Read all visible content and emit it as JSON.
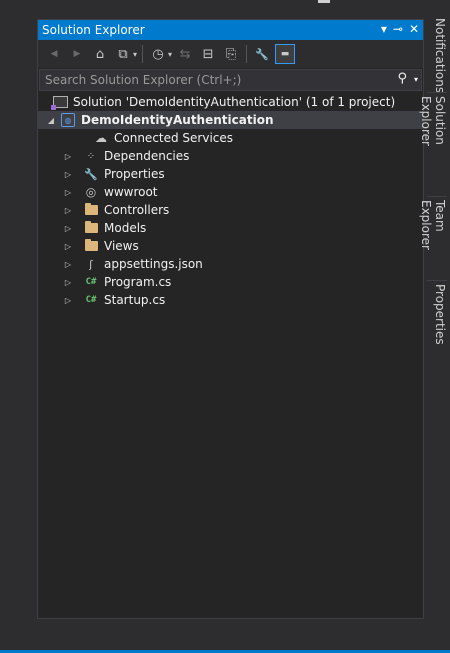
{
  "panel": {
    "title": "Solution Explorer",
    "title_icons": {
      "dropdown": "▾",
      "pin": "⊸",
      "close": "✕"
    }
  },
  "toolbar": {
    "buttons": [
      {
        "name": "back-button",
        "icon": "◀"
      },
      {
        "name": "forward-button",
        "icon": "▶"
      },
      {
        "name": "home-button",
        "icon": "⌂"
      },
      {
        "name": "switch-views-button",
        "icon": "⧉"
      },
      {
        "name": "pending-changes-button",
        "icon": "◷"
      },
      {
        "name": "sync-button",
        "icon": "⇆"
      },
      {
        "name": "collapse-all-button",
        "icon": "⊟"
      },
      {
        "name": "show-all-files-button",
        "icon": "⎘"
      },
      {
        "name": "properties-button",
        "icon": "🔧"
      },
      {
        "name": "preview-selected-button",
        "icon": "▬"
      }
    ]
  },
  "search": {
    "placeholder": "Search Solution Explorer (Ctrl+;)"
  },
  "tree": {
    "solution": "Solution 'DemoIdentityAuthentication' (1 of 1 project)",
    "project": "DemoIdentityAuthentication",
    "items": [
      {
        "label": "Connected Services",
        "icon": "cloud-icon",
        "expandable": false
      },
      {
        "label": "Dependencies",
        "icon": "dependencies-icon",
        "expandable": true
      },
      {
        "label": "Properties",
        "icon": "wrench-icon",
        "expandable": true
      },
      {
        "label": "wwwroot",
        "icon": "globe-icon",
        "expandable": true
      },
      {
        "label": "Controllers",
        "icon": "folder-icon",
        "expandable": true
      },
      {
        "label": "Models",
        "icon": "folder-icon",
        "expandable": true
      },
      {
        "label": "Views",
        "icon": "folder-icon",
        "expandable": true
      },
      {
        "label": "appsettings.json",
        "icon": "json-file-icon",
        "expandable": true
      },
      {
        "label": "Program.cs",
        "icon": "csharp-file-icon",
        "expandable": true
      },
      {
        "label": "Startup.cs",
        "icon": "csharp-file-icon",
        "expandable": true
      }
    ]
  },
  "side_tabs": [
    "Notifications",
    "Solution Explorer",
    "Team Explorer",
    "Properties"
  ],
  "colors": {
    "accent": "#007acc",
    "background": "#2d2d30",
    "panel": "#252526",
    "folder": "#dcb67a",
    "csharp": "#68c36e"
  }
}
